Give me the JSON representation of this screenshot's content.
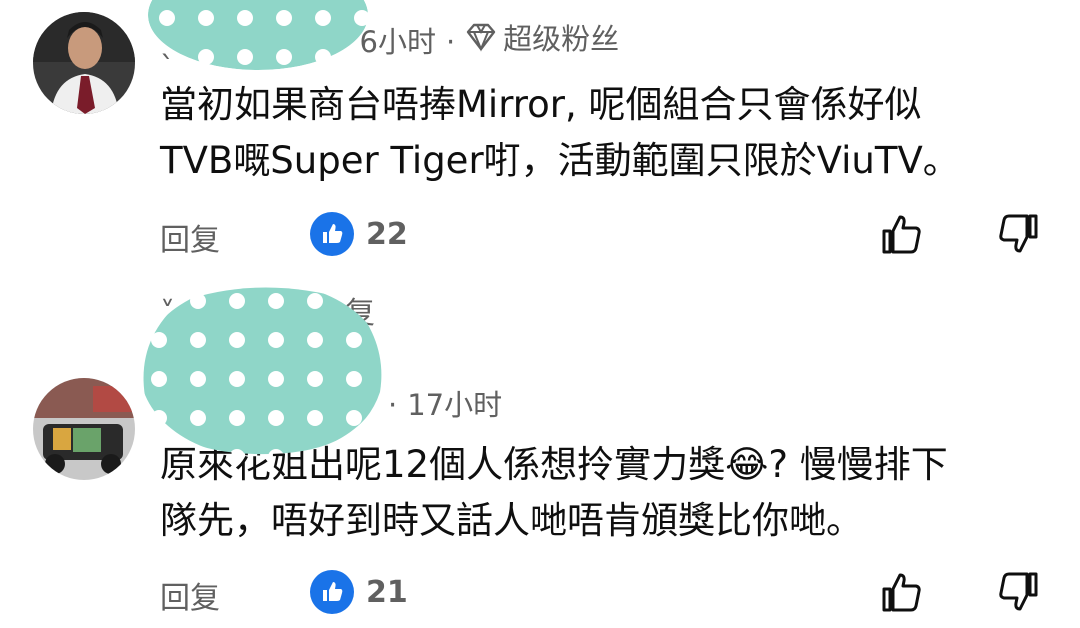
{
  "comments": [
    {
      "author_visible": "ˎ",
      "time": "6小时",
      "badge": "超级粉丝",
      "badge_icon": "diamond-icon",
      "text_line1": "當初如果商台唔捧Mirror, 呢個組合只會係好似",
      "text_line2": "TVB嘅Super Tiger咑，活動範圍只限於ViuTV。",
      "reply_label": "回复",
      "likes": "22",
      "thread_toggle_partial": "复"
    },
    {
      "time": "17小时",
      "text_line1": "原來花姐出呢12個人係想拎實力獎😂? 慢慢排下",
      "text_line2": "隊先，唔好到時又話人哋唔肯頒獎比你哋。",
      "reply_label": "回复",
      "likes": "21"
    }
  ],
  "colors": {
    "text": "#0f0f0f",
    "secondary": "#606060",
    "like_blue": "#065fd4",
    "redaction_teal": "#8fd6c8"
  }
}
